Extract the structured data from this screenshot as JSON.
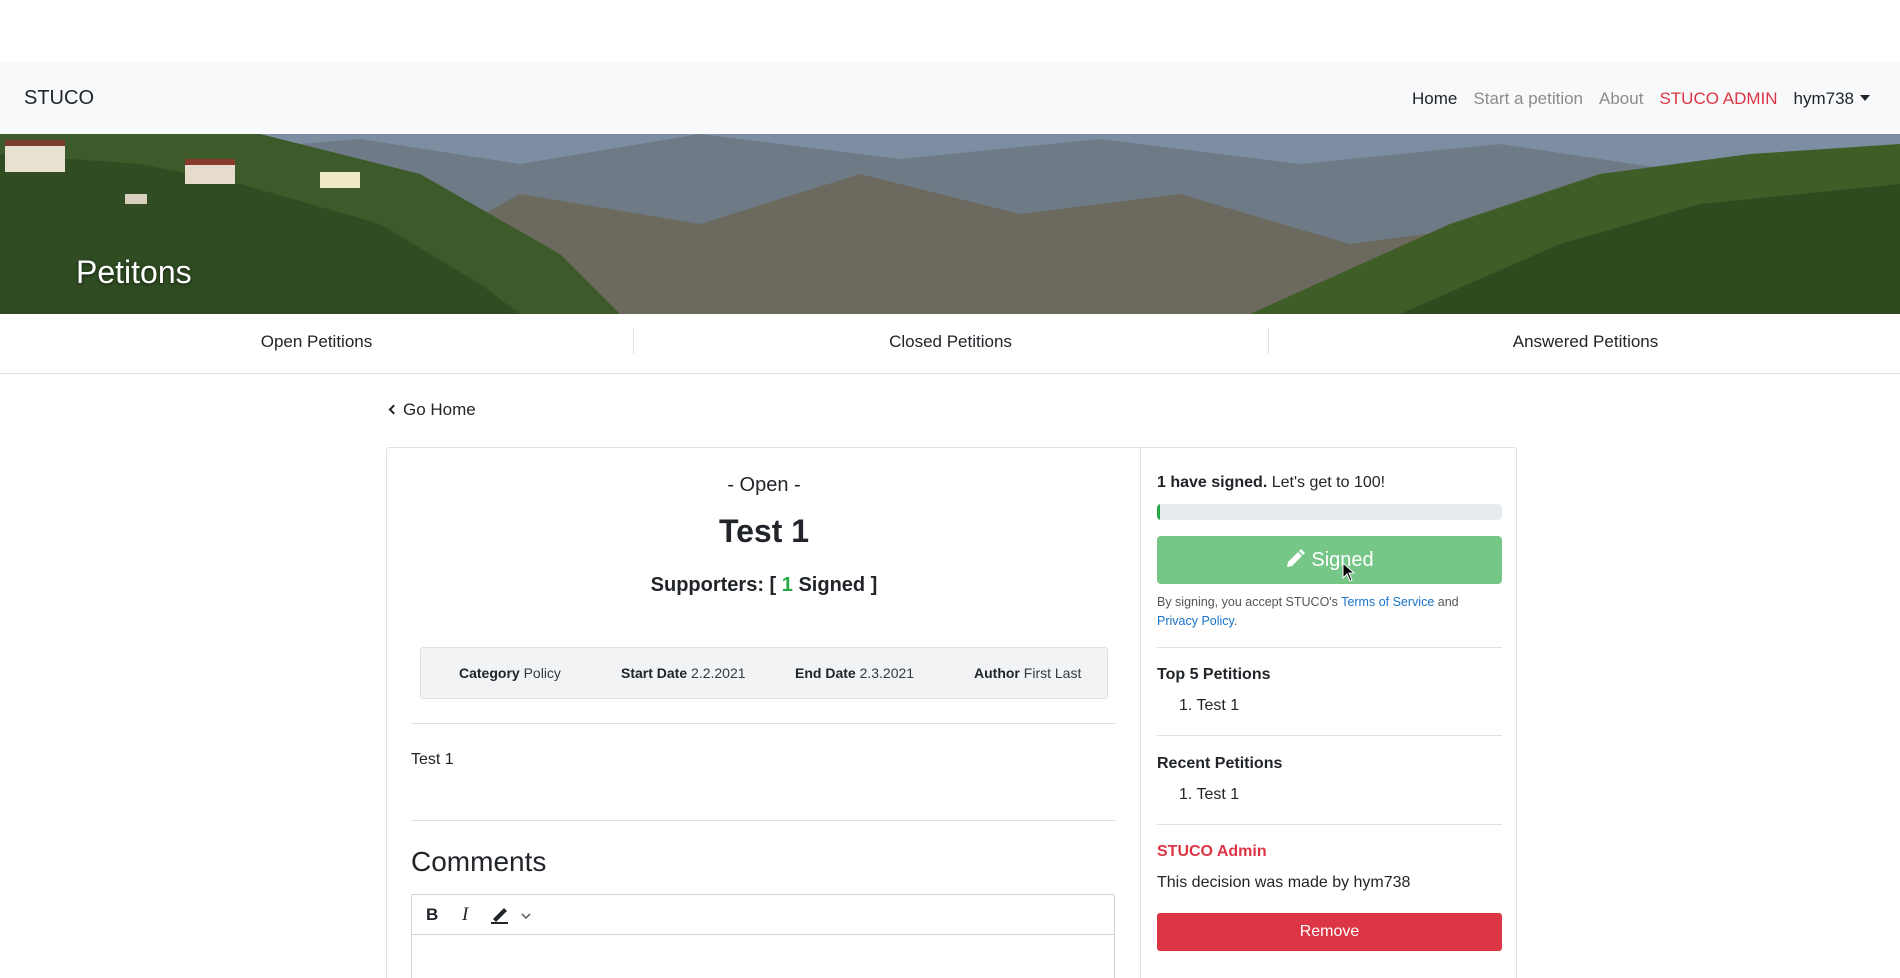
{
  "navbar": {
    "brand": "STUCO",
    "links": [
      "Home",
      "Start a petition",
      "About",
      "STUCO ADMIN"
    ],
    "user": "hym738"
  },
  "hero": {
    "title": "Petitons"
  },
  "tabs": [
    "Open Petitions",
    "Closed Petitions",
    "Answered Petitions"
  ],
  "go_home": "Go Home",
  "petition": {
    "status": "- Open -",
    "title": "Test 1",
    "supporters_prefix": "Supporters: [",
    "supporters_count": "1",
    "supporters_suffix": "Signed ]",
    "meta": {
      "category_label": "Category",
      "category_value": "Policy",
      "start_label": "Start Date",
      "start_value": "2.2.2021",
      "end_label": "End Date",
      "end_value": "2.3.2021",
      "author_label": "Author",
      "author_value": "First Last"
    },
    "body": "Test 1"
  },
  "comments": {
    "heading": "Comments",
    "bold": "B",
    "italic": "I"
  },
  "sidebar": {
    "signed_bold": "1 have signed.",
    "signed_rest": "Let's get to 100!",
    "progress_fraction": 0.01,
    "sign_button": "Signed",
    "terms_prefix": "By signing, you accept STUCO's",
    "terms_link": "Terms of Service",
    "terms_and": "and",
    "privacy_link": "Privacy Policy",
    "top5_title": "Top 5 Petitions",
    "top5_items": [
      "Test 1"
    ],
    "recent_title": "Recent Petitions",
    "recent_items": [
      "Test 1"
    ],
    "admin_title": "STUCO Admin",
    "decision_text": "This decision was made by hym738",
    "remove_button": "Remove"
  },
  "colors": {
    "success": "#28a745",
    "danger": "#dc3545",
    "link": "#1a73c8",
    "signed_btn": "#75c687"
  }
}
